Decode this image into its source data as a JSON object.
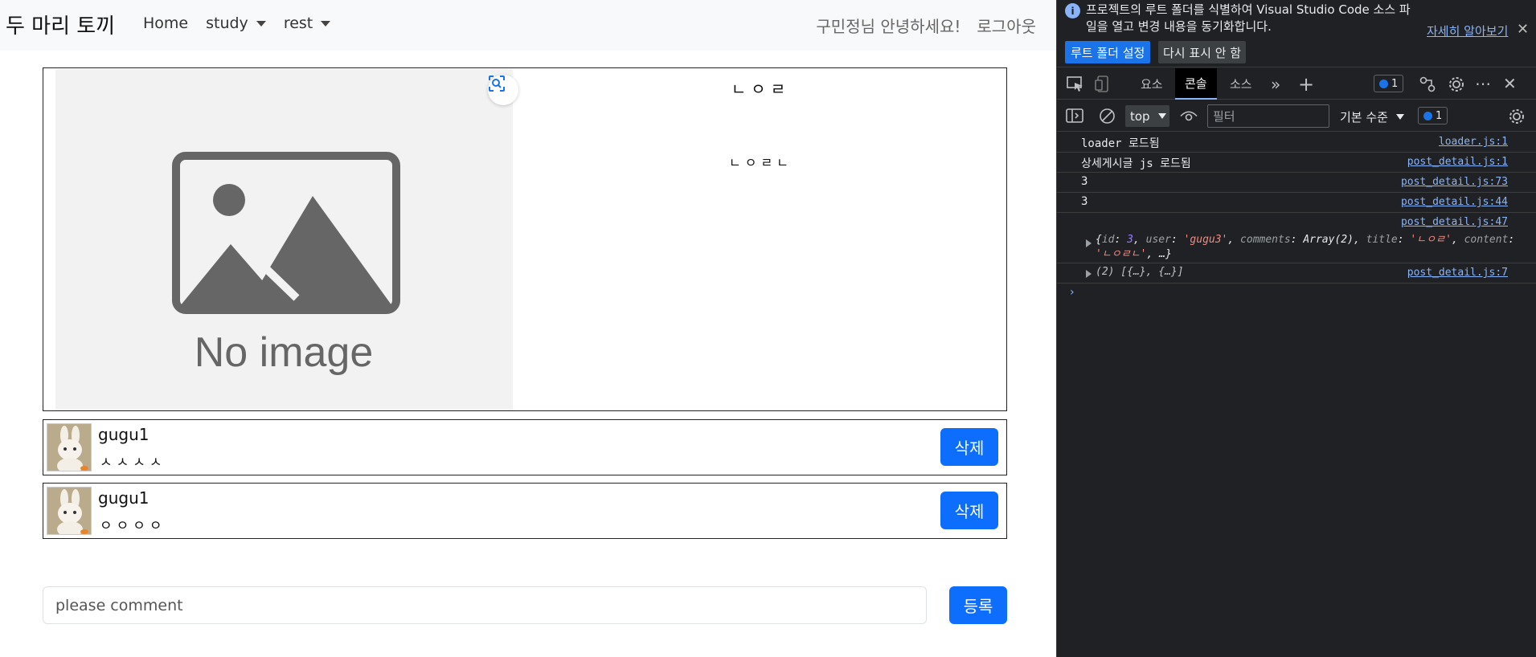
{
  "navbar": {
    "brand": "두 마리 토끼",
    "links": [
      {
        "label": "Home"
      },
      {
        "label": "study"
      },
      {
        "label": "rest"
      }
    ],
    "greeting": "구민정님 안녕하세요!",
    "logout": "로그아웃"
  },
  "post": {
    "image_text": "No image",
    "title": "ㄴㅇㄹ",
    "content": "ㄴㅇㄹㄴ"
  },
  "comments": [
    {
      "user": "gugu1",
      "text": "ㅅㅅㅅㅅ",
      "delete_label": "삭제"
    },
    {
      "user": "gugu1",
      "text": "ㅇㅇㅇㅇ",
      "delete_label": "삭제"
    }
  ],
  "comment_form": {
    "placeholder": "please comment",
    "submit_label": "등록"
  },
  "devtools": {
    "infobar": {
      "message": "프로젝트의 루트 폴더를 식별하여 Visual Studio Code 소스 파일을 열고 변경 내용을 동기화합니다.",
      "learn_more": "자세히 알아보기",
      "set_root_button": "루트 폴더 설정",
      "dont_show_button": "다시 표시 안 함"
    },
    "tabs": {
      "elements": "요소",
      "console": "콘솔",
      "sources": "소스",
      "issues_count": "1"
    },
    "toolbar": {
      "context": "top",
      "filter_placeholder": "필터",
      "levels": "기본 수준",
      "issues_count": "1"
    },
    "console_rows": [
      {
        "message": "loader 로드됨",
        "source": "loader.js:1"
      },
      {
        "message": "상세게시글 js 로드됨",
        "source": "post_detail.js:1"
      },
      {
        "message": "3",
        "source": "post_detail.js:73"
      },
      {
        "message": "3",
        "source": "post_detail.js:44"
      },
      {
        "source": "post_detail.js:47"
      },
      {
        "message": "(2) [{…}, {…}]",
        "source": "post_detail.js:7"
      }
    ],
    "object_preview": {
      "id_key": "id",
      "id_val": "3",
      "user_key": "user",
      "user_val": "'gugu3'",
      "comments_key": "comments",
      "comments_val": "Array(2)",
      "title_key": "title",
      "title_val": "'ㄴㅇㄹ'",
      "content_key": "content",
      "content_val": "'ㄴㅇㄹㄴ'",
      "ellipsis": "…"
    },
    "prompt": "›"
  },
  "colors": {
    "primary": "#0d6efd",
    "navbar_bg": "#f8f9fa",
    "devtools_bg": "#202124",
    "link_blue": "#8ab4f8"
  }
}
